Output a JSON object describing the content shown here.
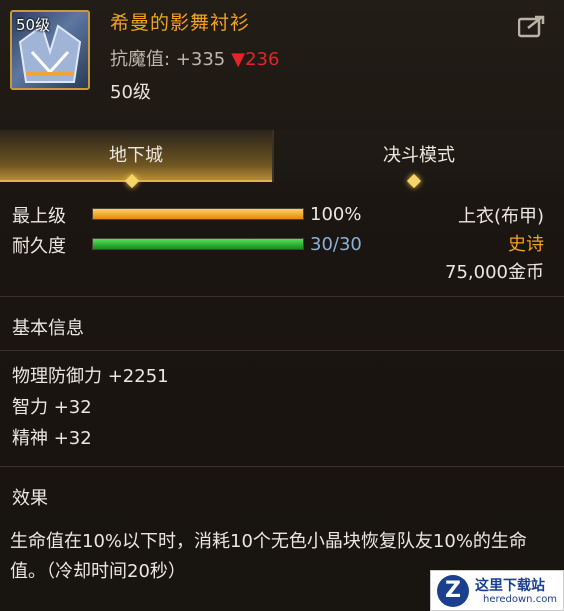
{
  "item": {
    "icon_level": "50级",
    "name": "希曼的影舞衬衫",
    "resist_label": "抗魔值: +335",
    "resist_down": "▼236",
    "required_level": "50级",
    "share_icon": "share-icon"
  },
  "tabs": [
    {
      "label": "地下城",
      "active": true
    },
    {
      "label": "决斗模式",
      "active": false
    }
  ],
  "bars": [
    {
      "label": "最上级",
      "value_text": "100%",
      "fraction": 1.0,
      "color": "#f0a020"
    },
    {
      "label": "耐久度",
      "value_text": "30/30",
      "fraction": 1.0,
      "color": "#2fb52f"
    }
  ],
  "info": {
    "slot": "上衣(布甲)",
    "rarity": "史诗",
    "rarity_color": "#f2a21e",
    "price": "75,000金币"
  },
  "basic": {
    "title": "基本信息",
    "stats": [
      "物理防御力 +2251",
      "智力 +32",
      "精神 +32"
    ]
  },
  "effect": {
    "title": "效果",
    "text": "生命值在10%以下时，消耗10个无色小晶块恢复队友10%的生命值。（冷却时间20秒）"
  },
  "watermark": {
    "logo": "Z",
    "title": "这里下载站",
    "url": "heredown.com"
  }
}
